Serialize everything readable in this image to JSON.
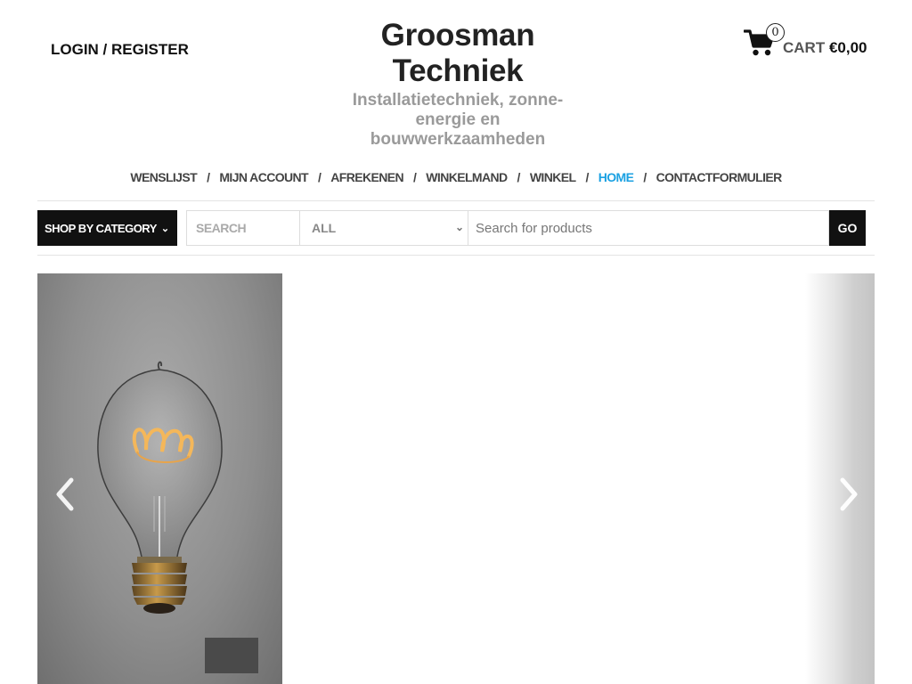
{
  "header": {
    "login_label": "LOGIN / REGISTER",
    "site_title_line1": "Groosman",
    "site_title_line2": "Techniek",
    "tagline_line1": "Installatietechniek, zonne-",
    "tagline_line2": "energie en",
    "tagline_line3": "bouwwerkzaamheden",
    "cart": {
      "count": "0",
      "label": "CART",
      "amount": "€0,00",
      "icon": "shopping-cart-icon"
    }
  },
  "nav": {
    "items": [
      {
        "label": "WENSLIJST"
      },
      {
        "label": "MIJN ACCOUNT"
      },
      {
        "label": "AFREKENEN"
      },
      {
        "label": "WINKELMAND"
      },
      {
        "label": "WINKEL"
      },
      {
        "label": "HOME",
        "active": true
      },
      {
        "label": "CONTACTFORMULIER"
      }
    ],
    "separator": "/",
    "active_color": "#1ba1e2"
  },
  "search_bar": {
    "category_button": "SHOP BY CATEGORY",
    "search_label": "SEARCH",
    "category_select": "ALL",
    "input_placeholder": "Search for products",
    "input_value": "",
    "go_label": "GO"
  },
  "slider": {
    "prev_icon": "chevron-left-icon",
    "next_icon": "chevron-right-icon",
    "slide_image": "light-bulb-photo"
  }
}
